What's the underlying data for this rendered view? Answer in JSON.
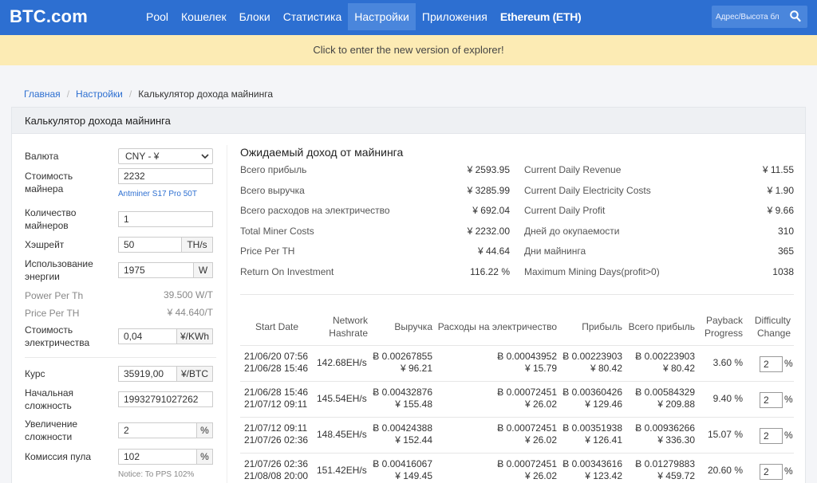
{
  "nav": {
    "logo": "BTC.com",
    "items": [
      "Pool",
      "Кошелек",
      "Блоки",
      "Статистика",
      "Настройки",
      "Приложения",
      "Ethereum (ETH)"
    ],
    "search_placeholder": "Адрес/Высота бл"
  },
  "banner": {
    "text": "Click to enter the new version of explorer!"
  },
  "breadcrumb": {
    "home": "Главная",
    "settings": "Настройки",
    "current": "Калькулятор дохода майнинга"
  },
  "panel": {
    "title": "Калькулятор дохода майнинга"
  },
  "form": {
    "currency": {
      "label": "Валюта",
      "value": "CNY - ¥"
    },
    "miner_cost": {
      "label": "Стоимость майнера",
      "value": "2232",
      "note": "Antminer S17 Pro 50T"
    },
    "miner_count": {
      "label": "Количество майнеров",
      "value": "1"
    },
    "hashrate": {
      "label": "Хэшрейт",
      "value": "50",
      "unit": "TH/s"
    },
    "power": {
      "label": "Использование энергии",
      "value": "1975",
      "unit": "W"
    },
    "power_per_th": {
      "label": "Power Per Th",
      "value": "39.500 W/T"
    },
    "price_per_th": {
      "label": "Price Per TH",
      "value": "¥ 44.640/T"
    },
    "electricity": {
      "label": "Стоимость электричества",
      "value": "0,04",
      "unit": "¥/KWh"
    },
    "rate": {
      "label": "Курс",
      "value": "35919,00",
      "unit": "¥/BTC"
    },
    "difficulty": {
      "label": "Начальная сложность",
      "value": "19932791027262"
    },
    "difficulty_increase": {
      "label": "Увеличение сложности",
      "value": "2",
      "unit": "%"
    },
    "pool_fee": {
      "label": "Комиссия пула",
      "value": "102",
      "unit": "%",
      "note": "Notice: To PPS 102%"
    }
  },
  "summary": {
    "title": "Ожидаемый доход от майнинга",
    "left": [
      {
        "k": "Всего прибыль",
        "v": "¥ 2593.95"
      },
      {
        "k": "Всего выручка",
        "v": "¥ 3285.99"
      },
      {
        "k": "Всего расходов на электричество",
        "v": "¥ 692.04"
      },
      {
        "k": "Total Miner Costs",
        "v": "¥ 2232.00"
      },
      {
        "k": "Price Per TH",
        "v": "¥ 44.64"
      },
      {
        "k": "Return On Investment",
        "v": "116.22 %"
      }
    ],
    "right": [
      {
        "k": "Current Daily Revenue",
        "v": "¥ 11.55"
      },
      {
        "k": "Current Daily Electricity Costs",
        "v": "¥ 1.90"
      },
      {
        "k": "Current Daily Profit",
        "v": "¥ 9.66"
      },
      {
        "k": "Дней до окупаемости",
        "v": "310"
      },
      {
        "k": "Дни майнинга",
        "v": "365"
      },
      {
        "k": "Maximum Mining Days(profit>0)",
        "v": "1038"
      }
    ]
  },
  "table": {
    "headers": {
      "start_date": "Start Date",
      "network_hashrate_1": "Network",
      "network_hashrate_2": "Hashrate",
      "revenue": "Выручка",
      "electricity": "Расходы на электричество",
      "profit": "Прибыль",
      "total_profit": "Всего прибыль",
      "payback_1": "Payback",
      "payback_2": "Progress",
      "diff_change_1": "Difficulty",
      "diff_change_2": "Change"
    },
    "rows": [
      {
        "d1": "21/06/20 07:56",
        "d2": "21/06/28 15:46",
        "hash": "142.68EH/s",
        "rev_btc": "Ƀ 0.00267855",
        "rev_cny": "¥ 96.21",
        "el_btc": "Ƀ 0.00043952",
        "el_cny": "¥ 15.79",
        "pr_btc": "Ƀ 0.00223903",
        "pr_cny": "¥ 80.42",
        "tp_btc": "Ƀ 0.00223903",
        "tp_cny": "¥ 80.42",
        "payback": "3.60 %",
        "diff": "2",
        "pct": "%"
      },
      {
        "d1": "21/06/28 15:46",
        "d2": "21/07/12 09:11",
        "hash": "145.54EH/s",
        "rev_btc": "Ƀ 0.00432876",
        "rev_cny": "¥ 155.48",
        "el_btc": "Ƀ 0.00072451",
        "el_cny": "¥ 26.02",
        "pr_btc": "Ƀ 0.00360426",
        "pr_cny": "¥ 129.46",
        "tp_btc": "Ƀ 0.00584329",
        "tp_cny": "¥ 209.88",
        "payback": "9.40 %",
        "diff": "2",
        "pct": "%"
      },
      {
        "d1": "21/07/12 09:11",
        "d2": "21/07/26 02:36",
        "hash": "148.45EH/s",
        "rev_btc": "Ƀ 0.00424388",
        "rev_cny": "¥ 152.44",
        "el_btc": "Ƀ 0.00072451",
        "el_cny": "¥ 26.02",
        "pr_btc": "Ƀ 0.00351938",
        "pr_cny": "¥ 126.41",
        "tp_btc": "Ƀ 0.00936266",
        "tp_cny": "¥ 336.30",
        "payback": "15.07 %",
        "diff": "2",
        "pct": "%"
      },
      {
        "d1": "21/07/26 02:36",
        "d2": "21/08/08 20:00",
        "hash": "151.42EH/s",
        "rev_btc": "Ƀ 0.00416067",
        "rev_cny": "¥ 149.45",
        "el_btc": "Ƀ 0.00072451",
        "el_cny": "¥ 26.02",
        "pr_btc": "Ƀ 0.00343616",
        "pr_cny": "¥ 123.42",
        "tp_btc": "Ƀ 0.01279883",
        "tp_cny": "¥ 459.72",
        "payback": "20.60 %",
        "diff": "2",
        "pct": "%"
      }
    ]
  },
  "colors": {
    "nav_bg": "#2d6fd1",
    "banner_bg": "#fcebb4",
    "link": "#2d6fd1"
  }
}
